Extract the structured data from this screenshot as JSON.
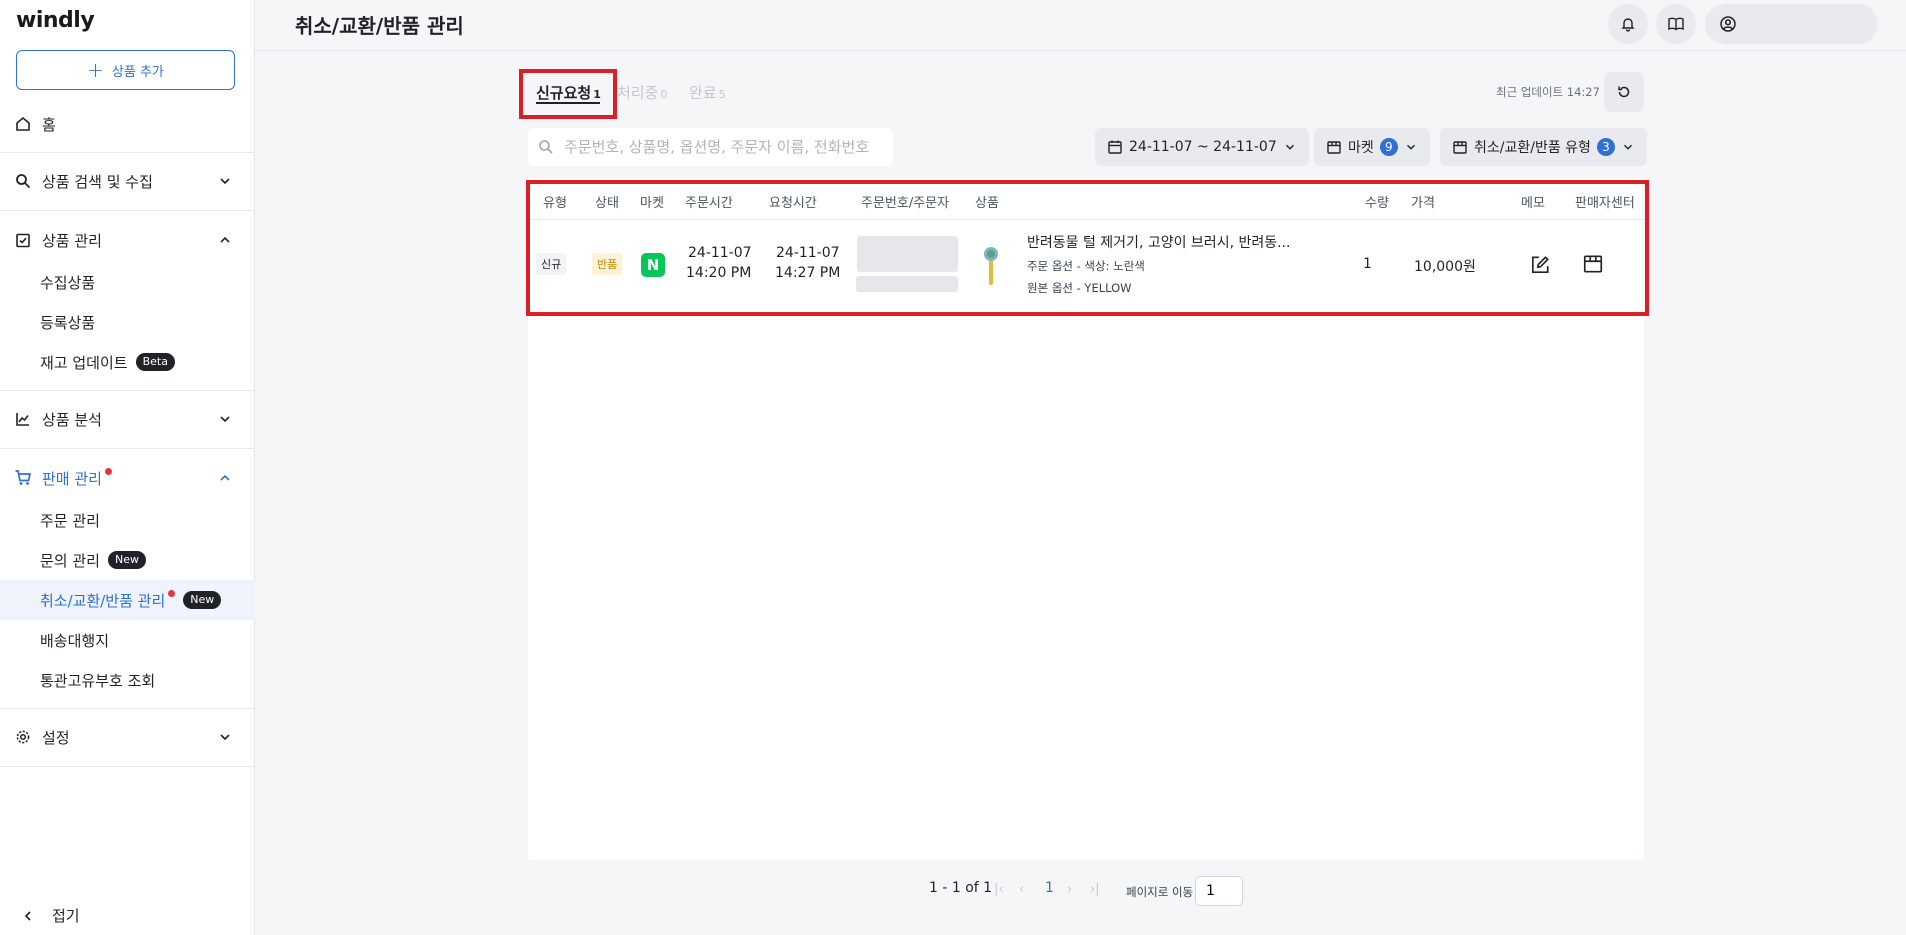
{
  "app": {
    "logo": "windly",
    "page_title": "취소/교환/반품 관리"
  },
  "sidebar": {
    "add_label": "상품 추가",
    "home": "홈",
    "search_collect": "상품 검색 및 수집",
    "product_mgmt": "상품 관리",
    "collected": "수집상품",
    "registered": "등록상품",
    "stock_update": "재고 업데이트",
    "beta": "Beta",
    "analysis": "상품 분석",
    "sales_mgmt": "판매 관리",
    "order_mgmt": "주문 관리",
    "inquiry_mgmt": "문의 관리",
    "new": "New",
    "cancel_mgmt": "취소/교환/반품 관리",
    "shipping_agent": "배송대행지",
    "customs_lookup": "통관고유부호 조회",
    "settings": "설정",
    "collapse": "접기"
  },
  "tabs": [
    {
      "label": "신규요청",
      "count": "1"
    },
    {
      "label": "처리중",
      "count": "0"
    },
    {
      "label": "완료",
      "count": "5"
    }
  ],
  "updated": "최근 업데이트 14:27",
  "search": {
    "placeholder": "주문번호, 상품명, 옵션명, 주문자 이름, 전화번호 검색"
  },
  "filters": {
    "date_range": "24-11-07 ~ 24-11-07",
    "market_label": "마켓",
    "market_count": "9",
    "type_label": "취소/교환/반품 유형",
    "type_count": "3"
  },
  "table": {
    "headers": [
      "유형",
      "상태",
      "마켓",
      "주문시간",
      "요청시간",
      "주문번호/주문자",
      "상품",
      "수량",
      "가격",
      "메모",
      "판매자센터"
    ],
    "row": {
      "type": "신규",
      "status": "반품",
      "market": "N",
      "order_date": "24-11-07",
      "order_time": "14:20 PM",
      "req_date": "24-11-07",
      "req_time": "14:27 PM",
      "product_name": "반려동물 털 제거기, 고양이 브러시, 반려동...",
      "order_option": "주문 옵션 - 색상: 노란색",
      "source_option": "원본 옵션 - YELLOW",
      "qty": "1",
      "price": "10,000원"
    }
  },
  "pagination": {
    "range": "1 - 1 of 1",
    "page": "1",
    "goto_label": "페이지로 이동",
    "goto_value": "1"
  },
  "colors": {
    "accent": "#2f6fd6",
    "highlight": "#dc1f26",
    "naver": "#03c75a"
  }
}
